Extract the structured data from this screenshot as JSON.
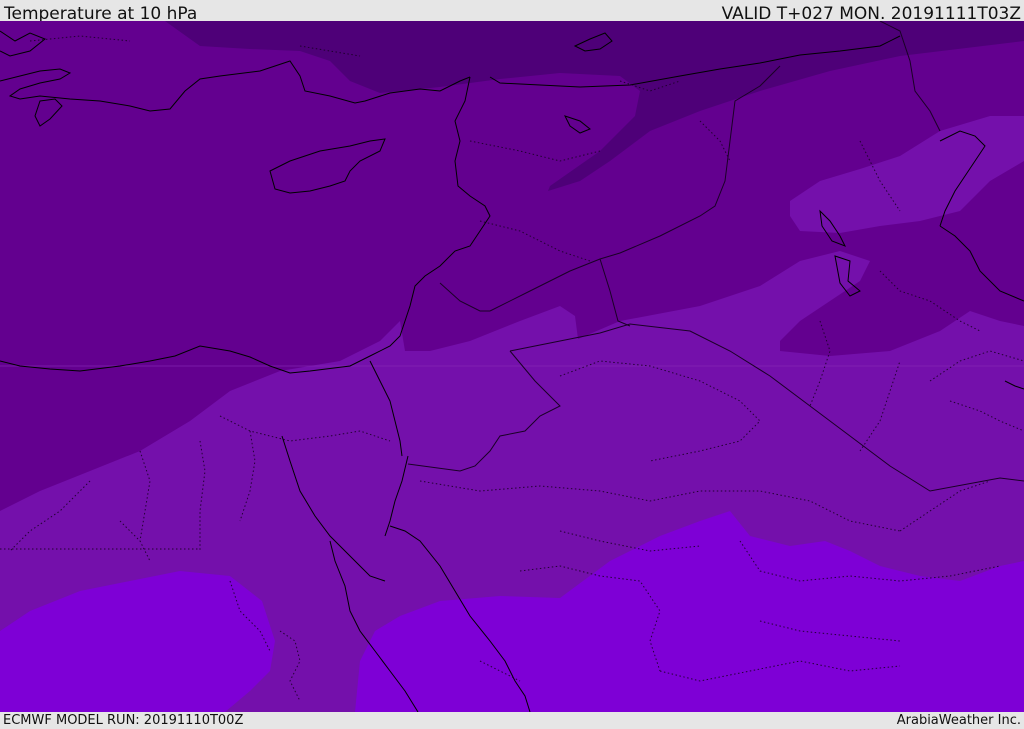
{
  "header": {
    "title": "Temperature at 10 hPa",
    "valid": "VALID T+027 MON. 20191111T03Z"
  },
  "footer": {
    "model_run": "ECMWF MODEL RUN: 20191110T00Z",
    "credit": "ArabiaWeather Inc."
  },
  "colors": {
    "band_darkest": "#4e0078",
    "band_dark": "#63008f",
    "band_mid": "#7410ab",
    "band_light": "#7e00d6",
    "coastline": "#000000",
    "border": "#1a0026",
    "background": "#e6e6e6"
  }
}
